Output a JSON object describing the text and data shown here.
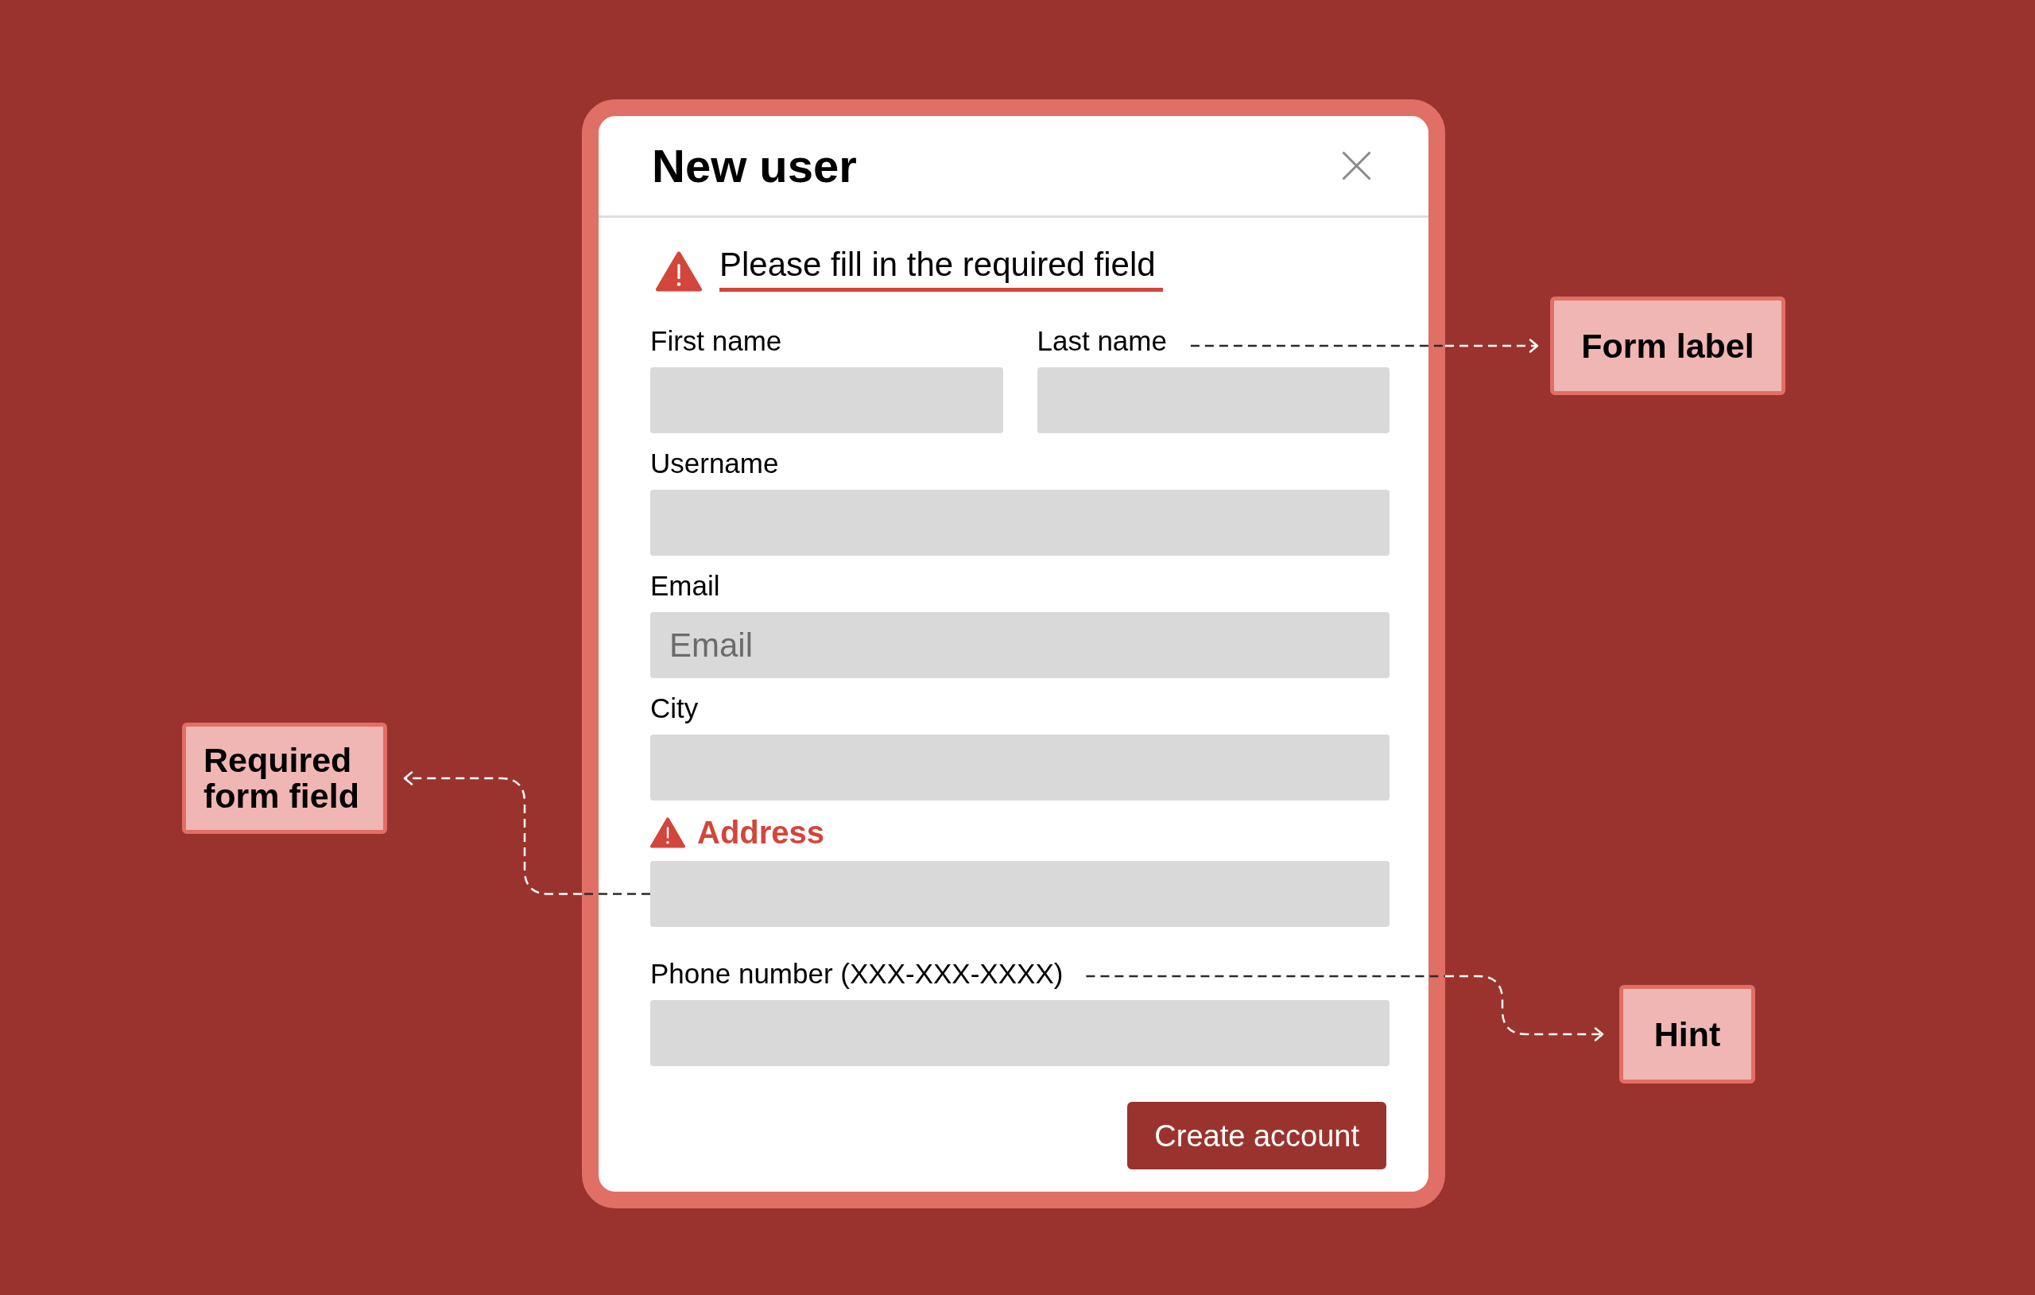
{
  "dialog": {
    "title": "New user",
    "alert": {
      "message": "Please fill in the required field"
    },
    "rows": [
      [
        {
          "label": "First name",
          "error": false
        },
        {
          "label": "Last name",
          "error": false
        }
      ],
      [
        {
          "label": "Username",
          "error": false
        }
      ],
      [
        {
          "label": "Email",
          "placeholder": "Email",
          "error": false
        }
      ],
      [
        {
          "label": "City",
          "error": false
        }
      ],
      [
        {
          "label": "Address",
          "error": true
        }
      ],
      [
        {
          "label": "Phone number (XXX-XXX-XXXX)",
          "error": false
        }
      ]
    ],
    "button": {
      "label": "Create account"
    }
  },
  "annotations": [
    {
      "text": "Form label"
    },
    {
      "text": "Required form field"
    },
    {
      "text": "Hint"
    }
  ]
}
